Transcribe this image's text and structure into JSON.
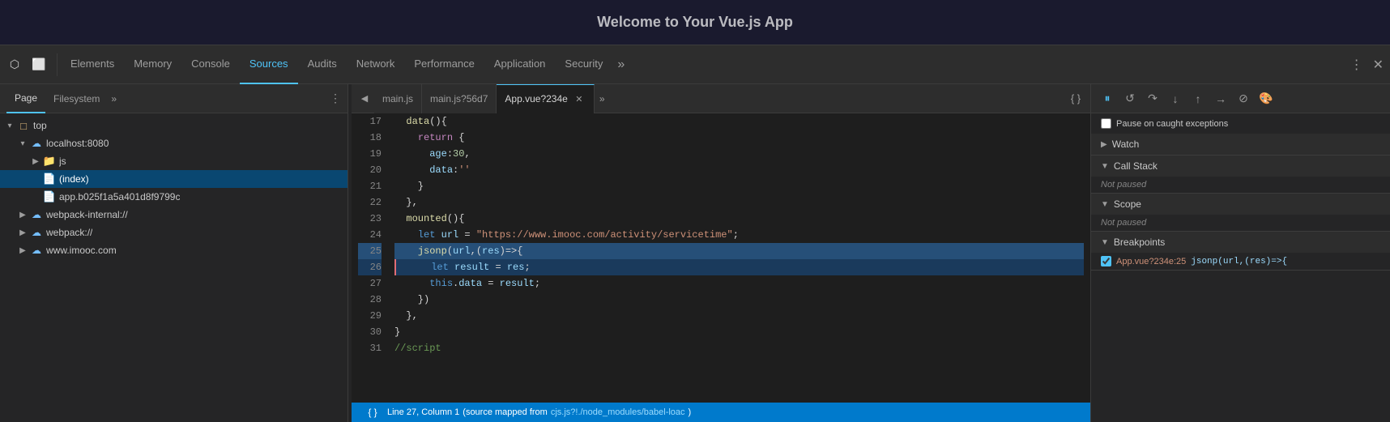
{
  "page": {
    "title": "Welcome to Your Vue.js App",
    "background": "#1a1a2e"
  },
  "tabs": [
    {
      "id": "elements",
      "label": "Elements",
      "active": false
    },
    {
      "id": "memory",
      "label": "Memory",
      "active": false
    },
    {
      "id": "console",
      "label": "Console",
      "active": false
    },
    {
      "id": "sources",
      "label": "Sources",
      "active": true
    },
    {
      "id": "audits",
      "label": "Audits",
      "active": false
    },
    {
      "id": "network",
      "label": "Network",
      "active": false
    },
    {
      "id": "performance",
      "label": "Performance",
      "active": false
    },
    {
      "id": "application",
      "label": "Application",
      "active": false
    },
    {
      "id": "security",
      "label": "Security",
      "active": false
    }
  ],
  "sidebar": {
    "tabs": [
      {
        "id": "page",
        "label": "Page",
        "active": true
      },
      {
        "id": "filesystem",
        "label": "Filesystem",
        "active": false
      }
    ],
    "tree": [
      {
        "id": "top",
        "label": "top",
        "type": "folder",
        "indent": 0,
        "expanded": true,
        "arrow": "▾"
      },
      {
        "id": "localhost",
        "label": "localhost:8080",
        "type": "globe",
        "indent": 1,
        "expanded": true,
        "arrow": "▾"
      },
      {
        "id": "js",
        "label": "js",
        "type": "folder",
        "indent": 2,
        "expanded": false,
        "arrow": "▶"
      },
      {
        "id": "index",
        "label": "(index)",
        "type": "file-selected",
        "indent": 2,
        "expanded": false,
        "arrow": "",
        "selected": true
      },
      {
        "id": "app-bundle",
        "label": "app.b025f1a5a401d8f9799c",
        "type": "file",
        "indent": 2,
        "expanded": false,
        "arrow": ""
      },
      {
        "id": "webpack-internal",
        "label": "webpack-internal://",
        "type": "globe",
        "indent": 1,
        "expanded": false,
        "arrow": "▶"
      },
      {
        "id": "webpack",
        "label": "webpack://",
        "type": "globe",
        "indent": 1,
        "expanded": false,
        "arrow": "▶"
      },
      {
        "id": "imooc",
        "label": "www.imooc.com",
        "type": "globe",
        "indent": 1,
        "expanded": false,
        "arrow": "▶"
      }
    ]
  },
  "editor": {
    "tabs": [
      {
        "id": "main-js",
        "label": "main.js",
        "active": false,
        "closeable": false
      },
      {
        "id": "main-js-hash",
        "label": "main.js?56d7",
        "active": false,
        "closeable": false
      },
      {
        "id": "app-vue",
        "label": "App.vue?234e",
        "active": true,
        "closeable": true
      }
    ],
    "lines": [
      {
        "num": 17,
        "content": "  data(){",
        "highlight": false,
        "breakpoint": false
      },
      {
        "num": 18,
        "content": "    return {",
        "highlight": false,
        "breakpoint": false
      },
      {
        "num": 19,
        "content": "      age:30,",
        "highlight": false,
        "breakpoint": false,
        "hasNum": true
      },
      {
        "num": 20,
        "content": "      data:''",
        "highlight": false,
        "breakpoint": false
      },
      {
        "num": 21,
        "content": "    }",
        "highlight": false,
        "breakpoint": false
      },
      {
        "num": 22,
        "content": "  },",
        "highlight": false,
        "breakpoint": false
      },
      {
        "num": 23,
        "content": "  mounted(){",
        "highlight": false,
        "breakpoint": false
      },
      {
        "num": 24,
        "content": "    let url = \"https://www.imooc.com/activity/servicetime\";",
        "highlight": false,
        "breakpoint": false
      },
      {
        "num": 25,
        "content": "    jsonp(url,(res)=>{",
        "highlight": true,
        "breakpoint": false
      },
      {
        "num": 26,
        "content": "      let result = res;",
        "highlight": true,
        "breakpoint": true
      },
      {
        "num": 27,
        "content": "      this.data = result;",
        "highlight": false,
        "breakpoint": false
      },
      {
        "num": 28,
        "content": "    })",
        "highlight": false,
        "breakpoint": false
      },
      {
        "num": 29,
        "content": "  },",
        "highlight": false,
        "breakpoint": false
      },
      {
        "num": 30,
        "content": "}",
        "highlight": false,
        "breakpoint": false
      },
      {
        "num": 31,
        "content": "//script",
        "highlight": false,
        "breakpoint": false,
        "isComment": true
      }
    ],
    "statusBar": {
      "text": "Line 27, Column 1",
      "mappedFrom": "(source mapped from",
      "mappedLink": "cjs.js?!./node_modules/babel-loac",
      "closeParen": ")"
    }
  },
  "rightPanel": {
    "sections": [
      {
        "id": "watch",
        "label": "Watch",
        "expanded": false,
        "arrow": "▶"
      },
      {
        "id": "callstack",
        "label": "Call Stack",
        "expanded": true,
        "arrow": "▼",
        "content": "Not paused"
      },
      {
        "id": "scope",
        "label": "Scope",
        "expanded": true,
        "arrow": "▼",
        "content": "Not paused"
      },
      {
        "id": "breakpoints",
        "label": "Breakpoints",
        "expanded": true,
        "arrow": "▼"
      }
    ],
    "pauseOnExceptions": "Pause on caught exceptions",
    "breakpoints": [
      {
        "id": "bp1",
        "file": "App.vue?234e:25",
        "code": "jsonp(url,(res)=>{"
      }
    ]
  },
  "icons": {
    "cursor": "⬡",
    "layers": "⬜",
    "pause": "⏸",
    "resume": "↺",
    "stepover": "↷",
    "stepinto": "↓",
    "stepout": "↑",
    "deactivate": "⊘",
    "close": "✕",
    "more": "≫",
    "kebab": "⋮",
    "chevron_right": "▶",
    "chevron_down": "▼"
  }
}
